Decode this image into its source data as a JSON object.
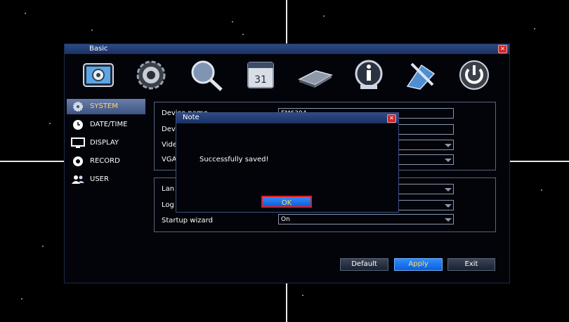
{
  "window": {
    "title": "Basic"
  },
  "toolbar": {
    "items": [
      {
        "icon": "settings-panel-icon"
      },
      {
        "icon": "gear-icon"
      },
      {
        "icon": "search-magnifier-icon"
      },
      {
        "icon": "calendar-3d-icon"
      },
      {
        "icon": "hard-disk-icon"
      },
      {
        "icon": "info-icon"
      },
      {
        "icon": "tools-icon"
      },
      {
        "icon": "power-icon"
      }
    ]
  },
  "sidebar": {
    "items": [
      {
        "label": "SYSTEM",
        "icon": "gear-icon",
        "active": true
      },
      {
        "label": "DATE/TIME",
        "icon": "clock-icon",
        "active": false
      },
      {
        "label": "DISPLAY",
        "icon": "monitor-icon",
        "active": false
      },
      {
        "label": "RECORD",
        "icon": "record-icon",
        "active": false
      },
      {
        "label": "USER",
        "icon": "users-icon",
        "active": false
      }
    ]
  },
  "panel1": {
    "rows": [
      {
        "label": "Device name",
        "value": "EM6304"
      },
      {
        "label": "Dev",
        "value": ""
      },
      {
        "label": "Vide",
        "value": ""
      },
      {
        "label": "VGA",
        "value": ""
      }
    ]
  },
  "panel2": {
    "rows": [
      {
        "label": "Lan",
        "value": ""
      },
      {
        "label": "Log",
        "value": ""
      },
      {
        "label": "Startup wizard",
        "value": "On"
      }
    ]
  },
  "buttons": {
    "default": "Default",
    "apply": "Apply",
    "exit": "Exit"
  },
  "modal": {
    "title": "Note",
    "message": "Successfully saved!",
    "ok": "OK"
  },
  "colors": {
    "accent": "#1a6fe8",
    "titlebar": "#2e4a86",
    "close": "#d3262b",
    "active_text": "#ffd36a"
  }
}
